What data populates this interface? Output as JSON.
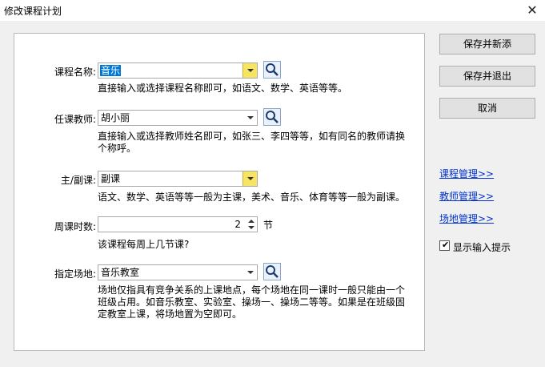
{
  "window": {
    "title": "修改课程计划"
  },
  "form": {
    "course_label": "课程名称:",
    "course_value": "音乐",
    "course_hint": "直接输入或选择课程名称即可，如语文、数学、英语等等。",
    "teacher_label": "任课教师:",
    "teacher_value": "胡小丽",
    "teacher_hint_1": "直接输入或选择教师姓名即可，如张三、李四等等，如有同名的教师请换",
    "teacher_hint_2": "个称呼。",
    "main_label": "主/副课:",
    "main_value": "副课",
    "main_hint": "语文、数学、英语等等一般为主课，美术、音乐、体育等等一般为副课。",
    "weekly_label": "周课时数:",
    "weekly_value": "2",
    "weekly_unit": "节",
    "weekly_hint": "该课程每周上几节课?",
    "venue_label": "指定场地:",
    "venue_value": "音乐教室",
    "venue_hint_1": "场地仅指具有竞争关系的上课地点，每个场地在同一课时一般只能由一个",
    "venue_hint_2": "班级占用。如音乐教室、实验室、操场一、操场二等等。如果是在班级固",
    "venue_hint_3": "定教室上课，将场地置为空即可。"
  },
  "buttons": {
    "save_new": "保存并新添",
    "save_exit": "保存并退出",
    "cancel": "取消"
  },
  "links": {
    "course_mgmt": "课程管理>>",
    "teacher_mgmt": "教师管理>>",
    "venue_mgmt": "场地管理>>"
  },
  "options": {
    "show_hint_label": "显示输入提示",
    "show_hint_checked": true
  },
  "colors": {
    "selection": "#0078d7",
    "link": "#0033cc",
    "dropdown_highlight": "#f7e463"
  }
}
